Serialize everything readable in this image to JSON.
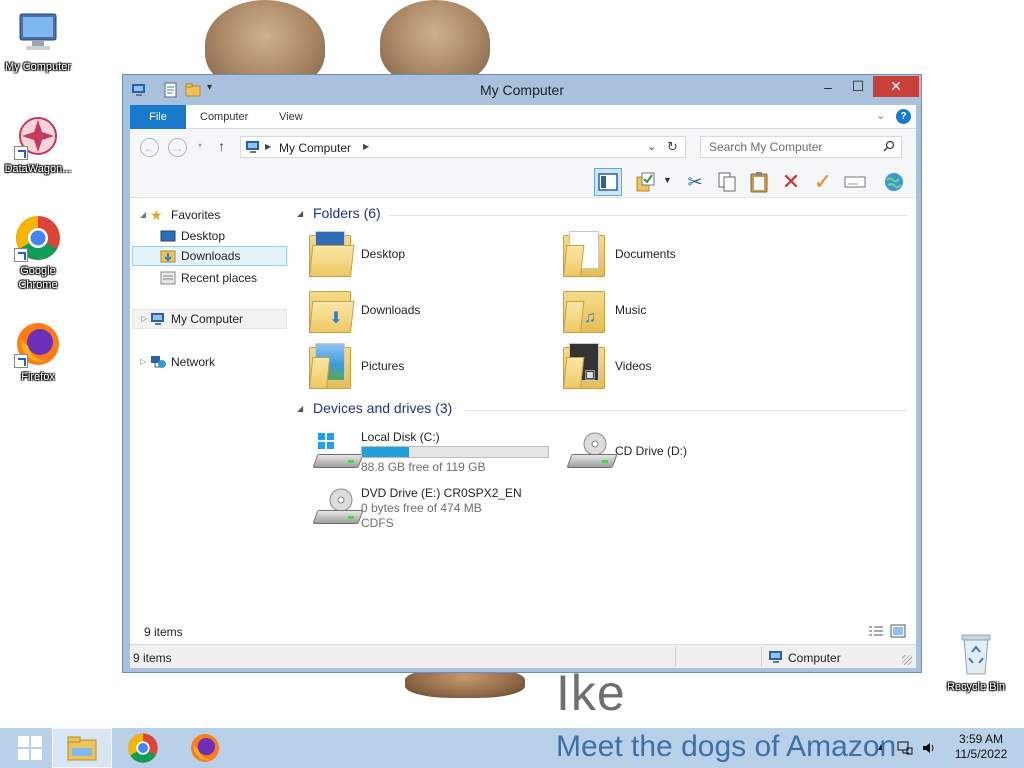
{
  "wallpaper": {
    "name": "Ike",
    "tagline": "Meet the dogs of Amazon"
  },
  "desktop": {
    "icons": [
      {
        "label": "My Computer",
        "icon": "computer-icon"
      },
      {
        "label": "DataWagon...",
        "icon": "datawagon-icon"
      },
      {
        "label": "Google Chrome",
        "icon": "chrome-icon"
      },
      {
        "label": "Firefox",
        "icon": "firefox-icon"
      },
      {
        "label": "Recycle Bin",
        "icon": "recycle-bin-icon"
      }
    ]
  },
  "window": {
    "title": "My Computer",
    "controls": {
      "minimize": "–",
      "maximize": "☐",
      "close": "✕"
    },
    "ribbon_tabs": [
      "File",
      "Computer",
      "View"
    ],
    "address": {
      "path": "My Computer"
    },
    "search": {
      "placeholder": "Search My Computer"
    },
    "nav": {
      "favorites": "Favorites",
      "desktop": "Desktop",
      "downloads": "Downloads",
      "recent": "Recent places",
      "my_computer": "My Computer",
      "network": "Network"
    },
    "groups": {
      "folders": "Folders (6)",
      "devices": "Devices and drives (3)"
    },
    "folders": [
      "Desktop",
      "Documents",
      "Downloads",
      "Music",
      "Pictures",
      "Videos"
    ],
    "drives": [
      {
        "name": "Local Disk (C:)",
        "free_text": "88.8 GB free of 119 GB",
        "used_fraction": 0.254
      },
      {
        "name": "CD Drive (D:)"
      },
      {
        "name": "DVD Drive (E:) CR0SPX2_EN",
        "free_text": "0 bytes free of 474 MB",
        "fs": "CDFS"
      }
    ],
    "footer_items": "9 items",
    "status": {
      "items": "9 items",
      "location": "Computer"
    }
  },
  "taskbar": {
    "apps": [
      "start-button",
      "file-explorer",
      "chrome",
      "firefox"
    ],
    "clock": {
      "time": "3:59 AM",
      "date": "11/5/2022"
    }
  },
  "colors": {
    "accent": "#1979ca",
    "window_frame": "#a9c1dc",
    "close": "#c7403a",
    "capacity": "#26a0da",
    "taskbar": "#b2cce6"
  }
}
